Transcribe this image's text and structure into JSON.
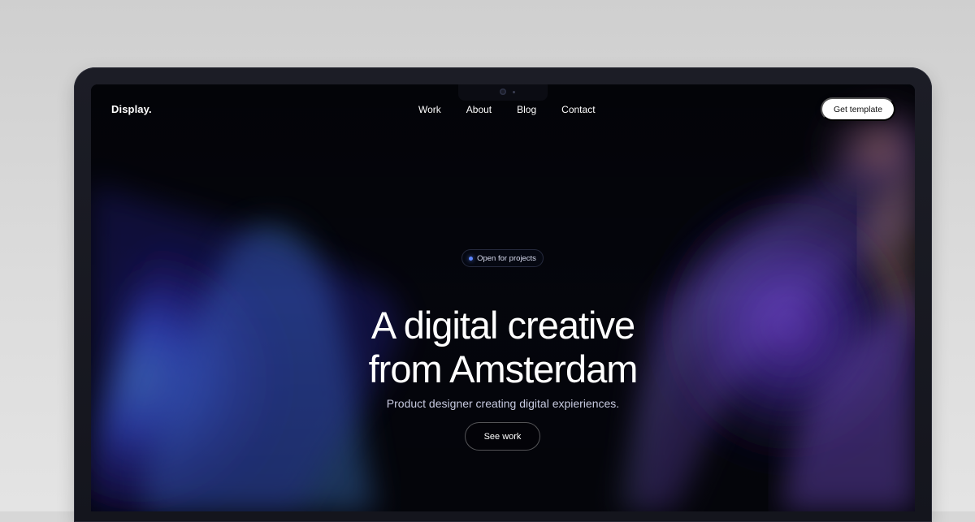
{
  "nav": {
    "logo": "Display.",
    "links": [
      "Work",
      "About",
      "Blog",
      "Contact"
    ],
    "cta": "Get template"
  },
  "hero": {
    "badge": "Open for projects",
    "headline_line_1": "A digital creative",
    "headline_line_2": "from Amsterdam",
    "subtitle": "Product designer creating digital expieriences.",
    "button": "See work"
  },
  "colors": {
    "background": "#05060d",
    "accent_blue": "#4f76f5",
    "accent_purple": "#7446c9",
    "accent_orange": "#d28c73",
    "text_primary": "#ffffff",
    "text_secondary": "#c7cae0",
    "device_frame": "#1c1d26"
  },
  "icons": {
    "camera": "camera-icon",
    "status": "status-dot-icon"
  }
}
